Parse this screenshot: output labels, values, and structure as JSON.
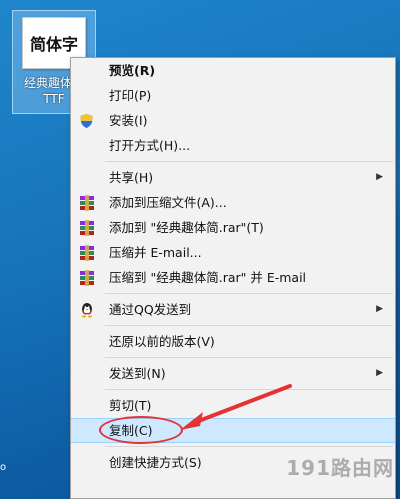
{
  "desktop_icon": {
    "preview_text": "简体字",
    "label": "经典趣体简\nTTF"
  },
  "menu": {
    "items": [
      {
        "label": "预览(R)",
        "bold": true
      },
      {
        "label": "打印(P)"
      },
      {
        "label": "安装(I)",
        "icon": "shield-icon"
      },
      {
        "label": "打开方式(H)..."
      },
      {
        "sep": true
      },
      {
        "label": "共享(H)",
        "submenu": true
      },
      {
        "label": "添加到压缩文件(A)...",
        "icon": "winrar-icon"
      },
      {
        "label": "添加到 \"经典趣体简.rar\"(T)",
        "icon": "winrar-icon"
      },
      {
        "label": "压缩并 E-mail...",
        "icon": "winrar-icon"
      },
      {
        "label": "压缩到 \"经典趣体简.rar\" 并 E-mail",
        "icon": "winrar-icon"
      },
      {
        "sep": true
      },
      {
        "label": "通过QQ发送到",
        "icon": "qq-penguin-icon",
        "submenu": true
      },
      {
        "sep": true
      },
      {
        "label": "还原以前的版本(V)"
      },
      {
        "sep": true
      },
      {
        "label": "发送到(N)",
        "submenu": true
      },
      {
        "sep": true
      },
      {
        "label": "剪切(T)"
      },
      {
        "label": "复制(C)",
        "highlighted": true
      },
      {
        "sep": true
      },
      {
        "label": "创建快捷方式(S)"
      }
    ]
  },
  "watermark": "191路由网",
  "annotation_color": "#e53232"
}
